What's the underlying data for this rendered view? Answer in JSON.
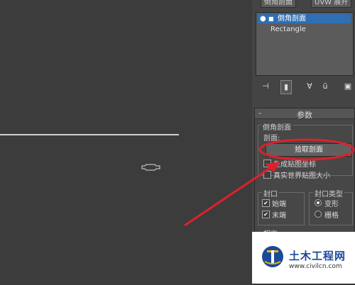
{
  "tabs": [
    "倒角剖面",
    "UVW 展开"
  ],
  "modifier_stack": {
    "selected": "倒角剖面",
    "items": [
      "Rectangle"
    ]
  },
  "rollout": {
    "title": "参数",
    "group_title": "倒角剖面",
    "profile_label": "剖面:",
    "pick_button": "拾取剖面",
    "options": [
      "生成贴图坐标",
      "真实世界贴图大小"
    ],
    "cap": {
      "title": "封口",
      "items": [
        {
          "label": "始端",
          "checked": true
        },
        {
          "label": "末端",
          "checked": true
        }
      ]
    },
    "cap_type": {
      "title": "封口类型",
      "items": [
        {
          "label": "变形",
          "selected": true
        },
        {
          "label": "栅格",
          "selected": false
        }
      ]
    },
    "next_group": "相交"
  },
  "watermark": {
    "title": "土木工程网",
    "url": "www.civilcn.com"
  },
  "colors": {
    "highlight": "#2f6fb4",
    "annotation": "#e0202a"
  }
}
